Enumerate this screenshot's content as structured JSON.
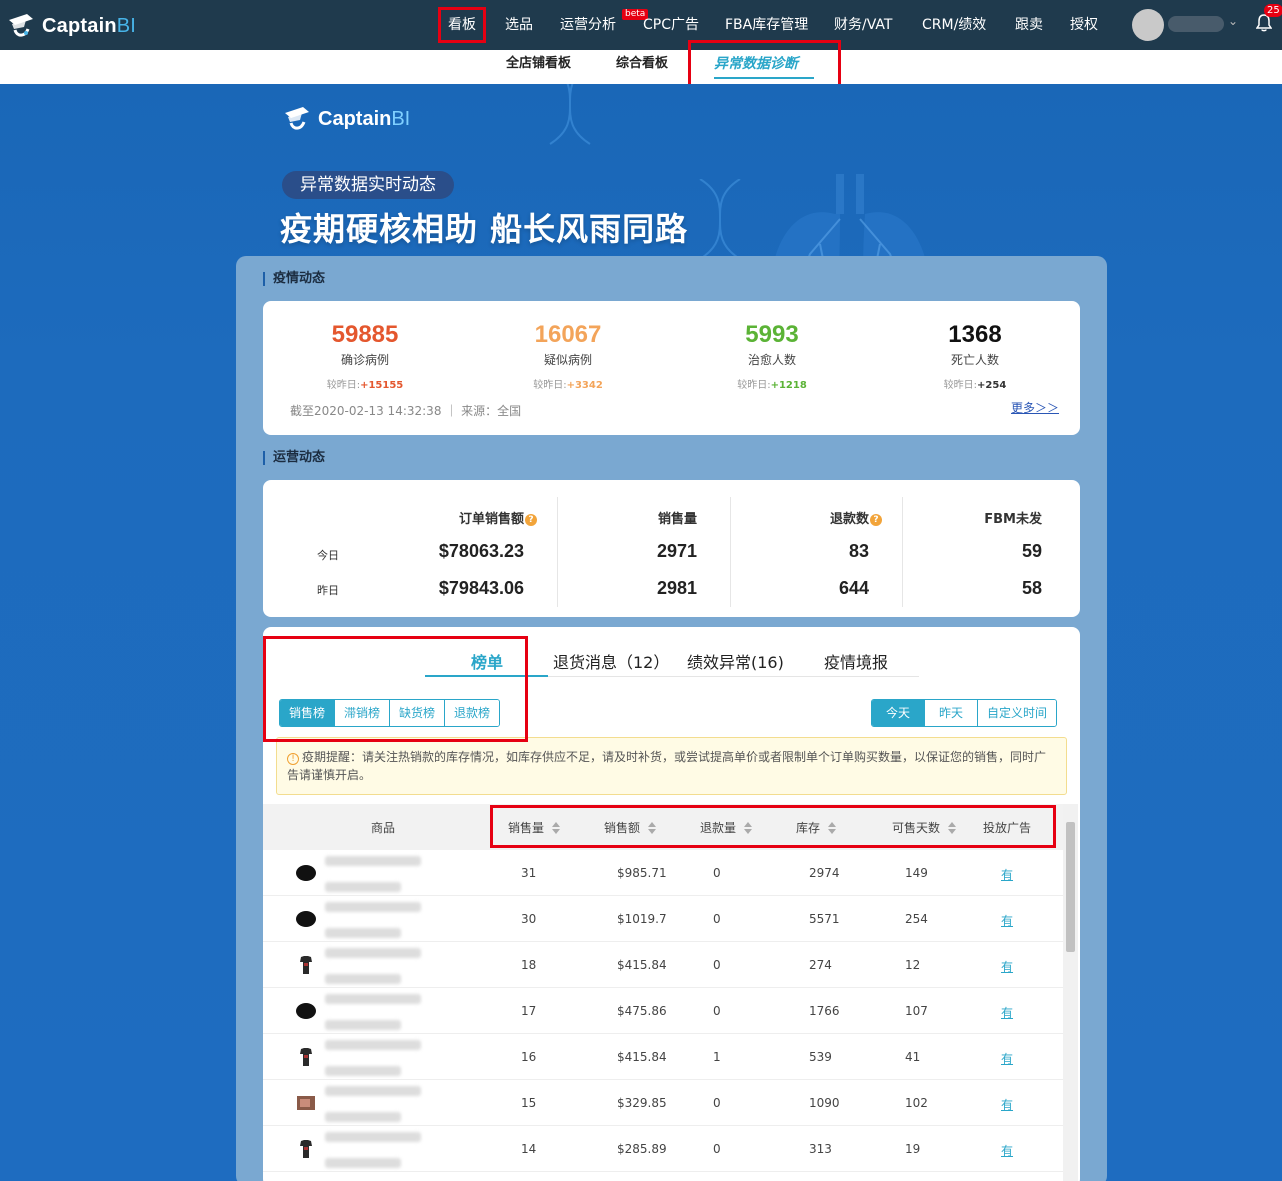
{
  "topnav": {
    "brand": "Captain",
    "brand_bi": "BI",
    "items": [
      "看板",
      "选品",
      "运营分析",
      "CPC广告",
      "FBA库存管理",
      "财务/VAT",
      "CRM/绩效",
      "跟卖",
      "授权"
    ],
    "beta": "beta",
    "notif_count": "25"
  },
  "subnav": {
    "items": [
      "全店铺看板",
      "综合看板",
      "异常数据诊断"
    ]
  },
  "banner": {
    "brand": "Captain",
    "brand_bi": "BI",
    "pill": "异常数据实时动态",
    "headline": "疫期硬核相助 船长风雨同路"
  },
  "epidemic": {
    "title": "疫情动态",
    "stats": [
      {
        "value": "59885",
        "label": "确诊病例",
        "delta_prefix": "较昨日:",
        "delta": "+15155",
        "color": "#e4572e",
        "delta_color": "#e4572e"
      },
      {
        "value": "16067",
        "label": "疑似病例",
        "delta_prefix": "较昨日:",
        "delta": "+3342",
        "color": "#f3a45a",
        "delta_color": "#f3a45a"
      },
      {
        "value": "5993",
        "label": "治愈人数",
        "delta_prefix": "较昨日:",
        "delta": "+1218",
        "color": "#5bb336",
        "delta_color": "#5bb336"
      },
      {
        "value": "1368",
        "label": "死亡人数",
        "delta_prefix": "较昨日:",
        "delta": "+254",
        "color": "#111111",
        "delta_color": "#333333"
      }
    ],
    "source": "截至2020-02-13 14:32:38 ｜ 来源：全国",
    "more": "更多＞＞"
  },
  "operations": {
    "title": "运营动态",
    "headers": [
      "订单销售额",
      "销售量",
      "退款数",
      "FBM未发"
    ],
    "rows": [
      {
        "label": "今日",
        "values": [
          "$78063.23",
          "2971",
          "83",
          "59"
        ]
      },
      {
        "label": "昨日",
        "values": [
          "$79843.06",
          "2981",
          "644",
          "58"
        ]
      }
    ]
  },
  "tabs": [
    "榜单",
    "退货消息（12）",
    "绩效异常(16)",
    "疫情境报"
  ],
  "rank_filters": [
    "销售榜",
    "滞销榜",
    "缺货榜",
    "退款榜"
  ],
  "time_filters": [
    "今天",
    "昨天",
    "自定义时间"
  ],
  "notice": "疫期提醒：请关注热销款的库存情况，如库存供应不足，请及时补货，或尝试提高单价或者限制单个订单购买数量，以保证您的销售，同时广告请谨慎开启。",
  "table": {
    "headers": [
      "商品",
      "销售量",
      "销售额",
      "退款量",
      "库存",
      "可售天数",
      "投放广告"
    ],
    "rows": [
      {
        "sales": "31",
        "amount": "$985.71",
        "refund": "0",
        "stock": "2974",
        "days": "149",
        "ad": "有",
        "thumb": "round"
      },
      {
        "sales": "30",
        "amount": "$1019.7",
        "refund": "0",
        "stock": "5571",
        "days": "254",
        "ad": "有",
        "thumb": "round"
      },
      {
        "sales": "18",
        "amount": "$415.84",
        "refund": "0",
        "stock": "274",
        "days": "12",
        "ad": "有",
        "thumb": "shirt"
      },
      {
        "sales": "17",
        "amount": "$475.86",
        "refund": "0",
        "stock": "1766",
        "days": "107",
        "ad": "有",
        "thumb": "round"
      },
      {
        "sales": "16",
        "amount": "$415.84",
        "refund": "1",
        "stock": "539",
        "days": "41",
        "ad": "有",
        "thumb": "shirt"
      },
      {
        "sales": "15",
        "amount": "$329.85",
        "refund": "0",
        "stock": "1090",
        "days": "102",
        "ad": "有",
        "thumb": "photo"
      },
      {
        "sales": "14",
        "amount": "$285.89",
        "refund": "0",
        "stock": "313",
        "days": "19",
        "ad": "有",
        "thumb": "shirt"
      }
    ]
  },
  "colors": {
    "accent": "#2aa6c9",
    "highlight_box": "#e60012",
    "nav_bg": "#1f3a4d"
  }
}
